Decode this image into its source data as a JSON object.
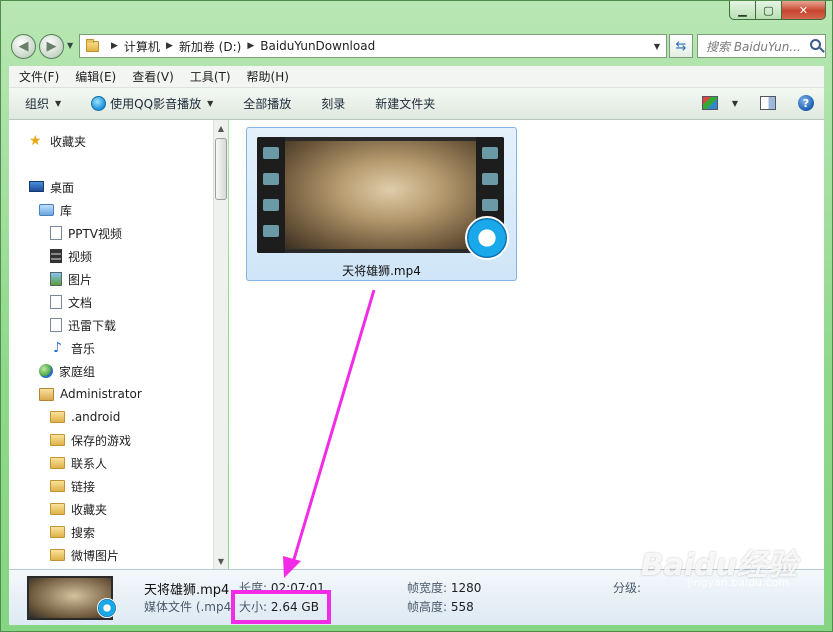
{
  "address_bar": {
    "crumbs": [
      "计算机",
      "新加卷 (D:)",
      "BaiduYunDownload"
    ],
    "search_placeholder": "搜索 BaiduYun..."
  },
  "menu": [
    "文件(F)",
    "编辑(E)",
    "查看(V)",
    "工具(T)",
    "帮助(H)"
  ],
  "toolbar": {
    "organize": "组织",
    "play_with": "使用QQ影音播放",
    "play_all": "全部播放",
    "burn": "刻录",
    "new_folder": "新建文件夹"
  },
  "nav": {
    "favorites": "收藏夹",
    "desktop": "桌面",
    "libraries": "库",
    "lib_items": [
      "PPTV视频",
      "视频",
      "图片",
      "文档",
      "迅雷下载",
      "音乐"
    ],
    "homegroup": "家庭组",
    "user": "Administrator",
    "user_items": [
      ".android",
      "保存的游戏",
      "联系人",
      "链接",
      "收藏夹",
      "搜索",
      "微博图片"
    ]
  },
  "file": {
    "name": "天将雄狮.mp4"
  },
  "details": {
    "name": "天将雄狮.mp4",
    "type": "媒体文件 (.mp4",
    "length_label": "长度:",
    "length_value": "02:07:01",
    "size_label": "大小:",
    "size_value": "2.64 GB",
    "frame_width_label": "帧宽度:",
    "frame_width_value": "1280",
    "frame_height_label": "帧高度:",
    "frame_height_value": "558",
    "rating_label": "分级:"
  },
  "watermark": {
    "brand": "Baidu经验",
    "url": "jingyan.baidu.com"
  },
  "colors": {
    "annotation": "#f22ce6",
    "selection": "#cfe6f8"
  }
}
